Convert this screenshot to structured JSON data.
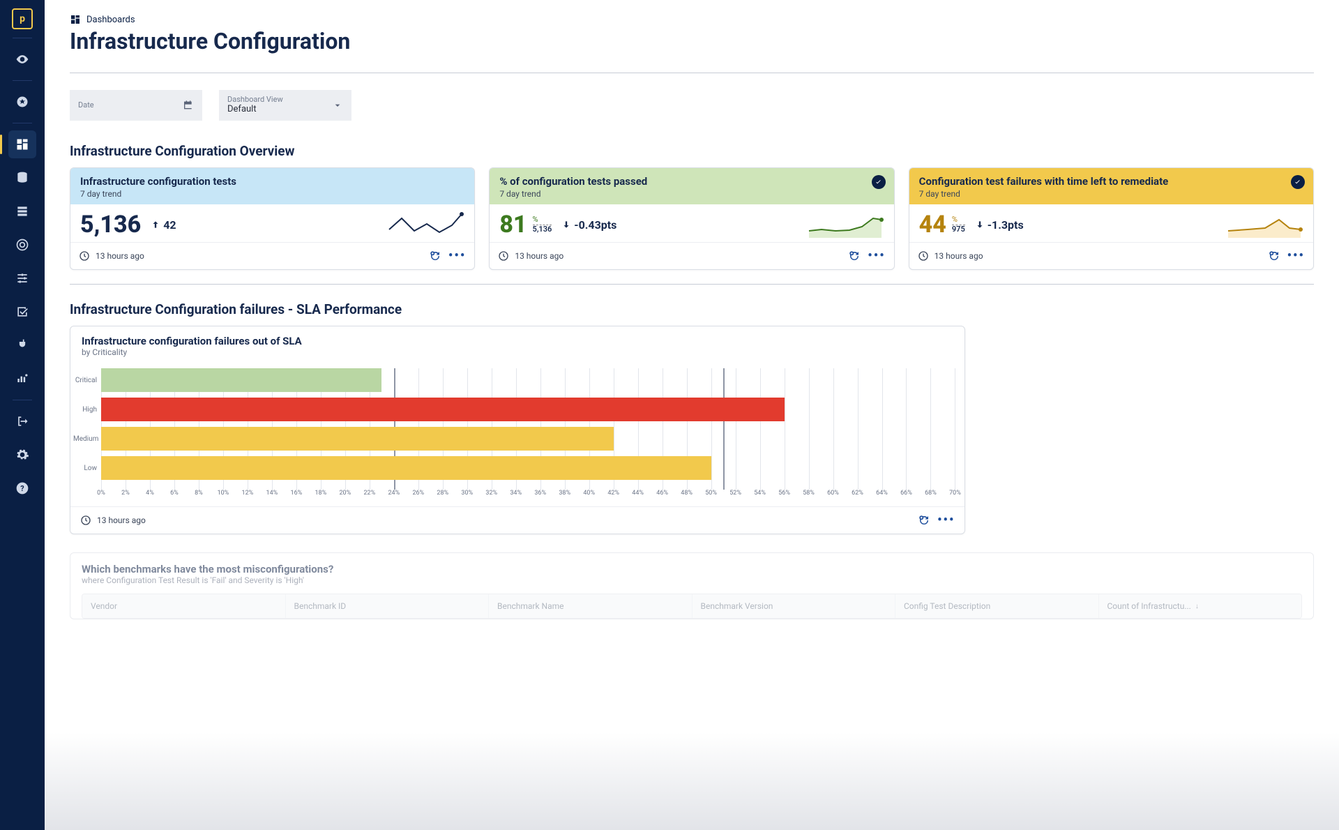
{
  "breadcrumb": "Dashboards",
  "page_title": "Infrastructure Configuration",
  "filters": {
    "date": {
      "label": "Date",
      "value": ""
    },
    "view": {
      "label": "Dashboard View",
      "value": "Default"
    }
  },
  "sections": {
    "overview_title": "Infrastructure Configuration Overview",
    "sla_title": "Infrastructure Configuration failures - SLA Performance"
  },
  "cards": {
    "tests": {
      "title": "Infrastructure configuration tests",
      "sub": "7 day trend",
      "value": "5,136",
      "delta": "42",
      "delta_dir": "up",
      "footer_time": "13 hours ago"
    },
    "pct_passed": {
      "title": "% of configuration tests passed",
      "sub": "7 day trend",
      "value": "81",
      "pct_unit": "%",
      "denom": "5,136",
      "delta": "-0.43pts",
      "delta_dir": "down",
      "footer_time": "13 hours ago"
    },
    "failures_remediate": {
      "title": "Configuration test failures with time left to remediate",
      "sub": "7 day trend",
      "value": "44",
      "pct_unit": "%",
      "denom": "975",
      "delta": "-1.3pts",
      "delta_dir": "down",
      "footer_time": "13 hours ago"
    }
  },
  "sla_card": {
    "title": "Infrastructure configuration failures out of SLA",
    "sub": "by Criticality",
    "footer_time": "13 hours ago"
  },
  "chart_data": {
    "type": "bar",
    "orientation": "horizontal",
    "categories": [
      "Critical",
      "High",
      "Medium",
      "Low"
    ],
    "values": [
      23,
      56,
      42,
      50
    ],
    "colors": [
      "#b9d6a3",
      "#e23b2e",
      "#f2c94c",
      "#f2c94c"
    ],
    "xlabel": "",
    "ylabel": "",
    "x_unit": "%",
    "xlim": [
      0,
      70
    ],
    "x_ticks": [
      0,
      2,
      4,
      6,
      8,
      10,
      12,
      14,
      16,
      18,
      20,
      22,
      24,
      26,
      28,
      30,
      32,
      34,
      36,
      38,
      40,
      42,
      44,
      46,
      48,
      50,
      52,
      54,
      56,
      58,
      60,
      62,
      64,
      66,
      68,
      70
    ],
    "reference_lines": [
      24,
      51
    ]
  },
  "benchmarks": {
    "title": "Which benchmarks have the most misconfigurations?",
    "sub": "where Configuration Test Result is 'Fail' and Severity is 'High'",
    "columns": [
      "Vendor",
      "Benchmark ID",
      "Benchmark Name",
      "Benchmark Version",
      "Config Test Description",
      "Count of Infrastructu..."
    ]
  }
}
